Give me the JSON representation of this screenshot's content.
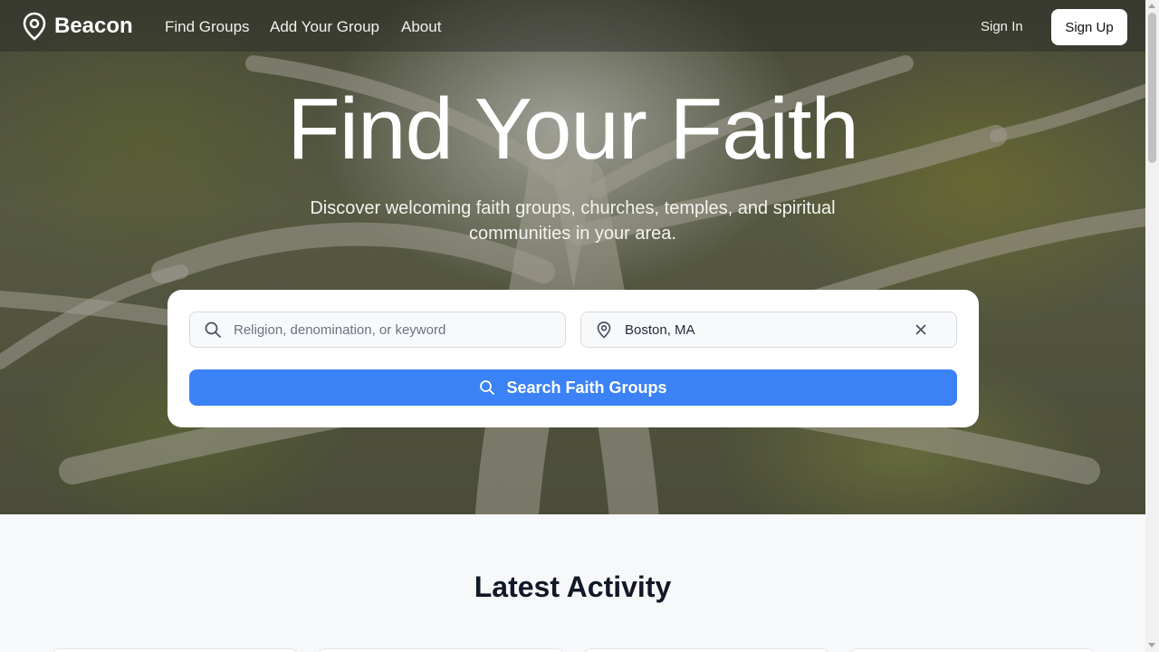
{
  "nav": {
    "brand": "Beacon",
    "links": [
      "Find Groups",
      "Add Your Group",
      "About"
    ],
    "sign_in": "Sign In",
    "sign_up": "Sign Up"
  },
  "hero": {
    "title": "Find Your Faith",
    "subtitle": "Discover welcoming faith groups, churches, temples, and spiritual communities in your area."
  },
  "search": {
    "keyword_placeholder": "Religion, denomination, or keyword",
    "keyword_value": "",
    "location_value": "Boston, MA",
    "button_label": "Search Faith Groups"
  },
  "activity": {
    "title": "Latest Activity"
  },
  "colors": {
    "accent": "#3b82f6",
    "page_background": "#f7f8fa"
  }
}
